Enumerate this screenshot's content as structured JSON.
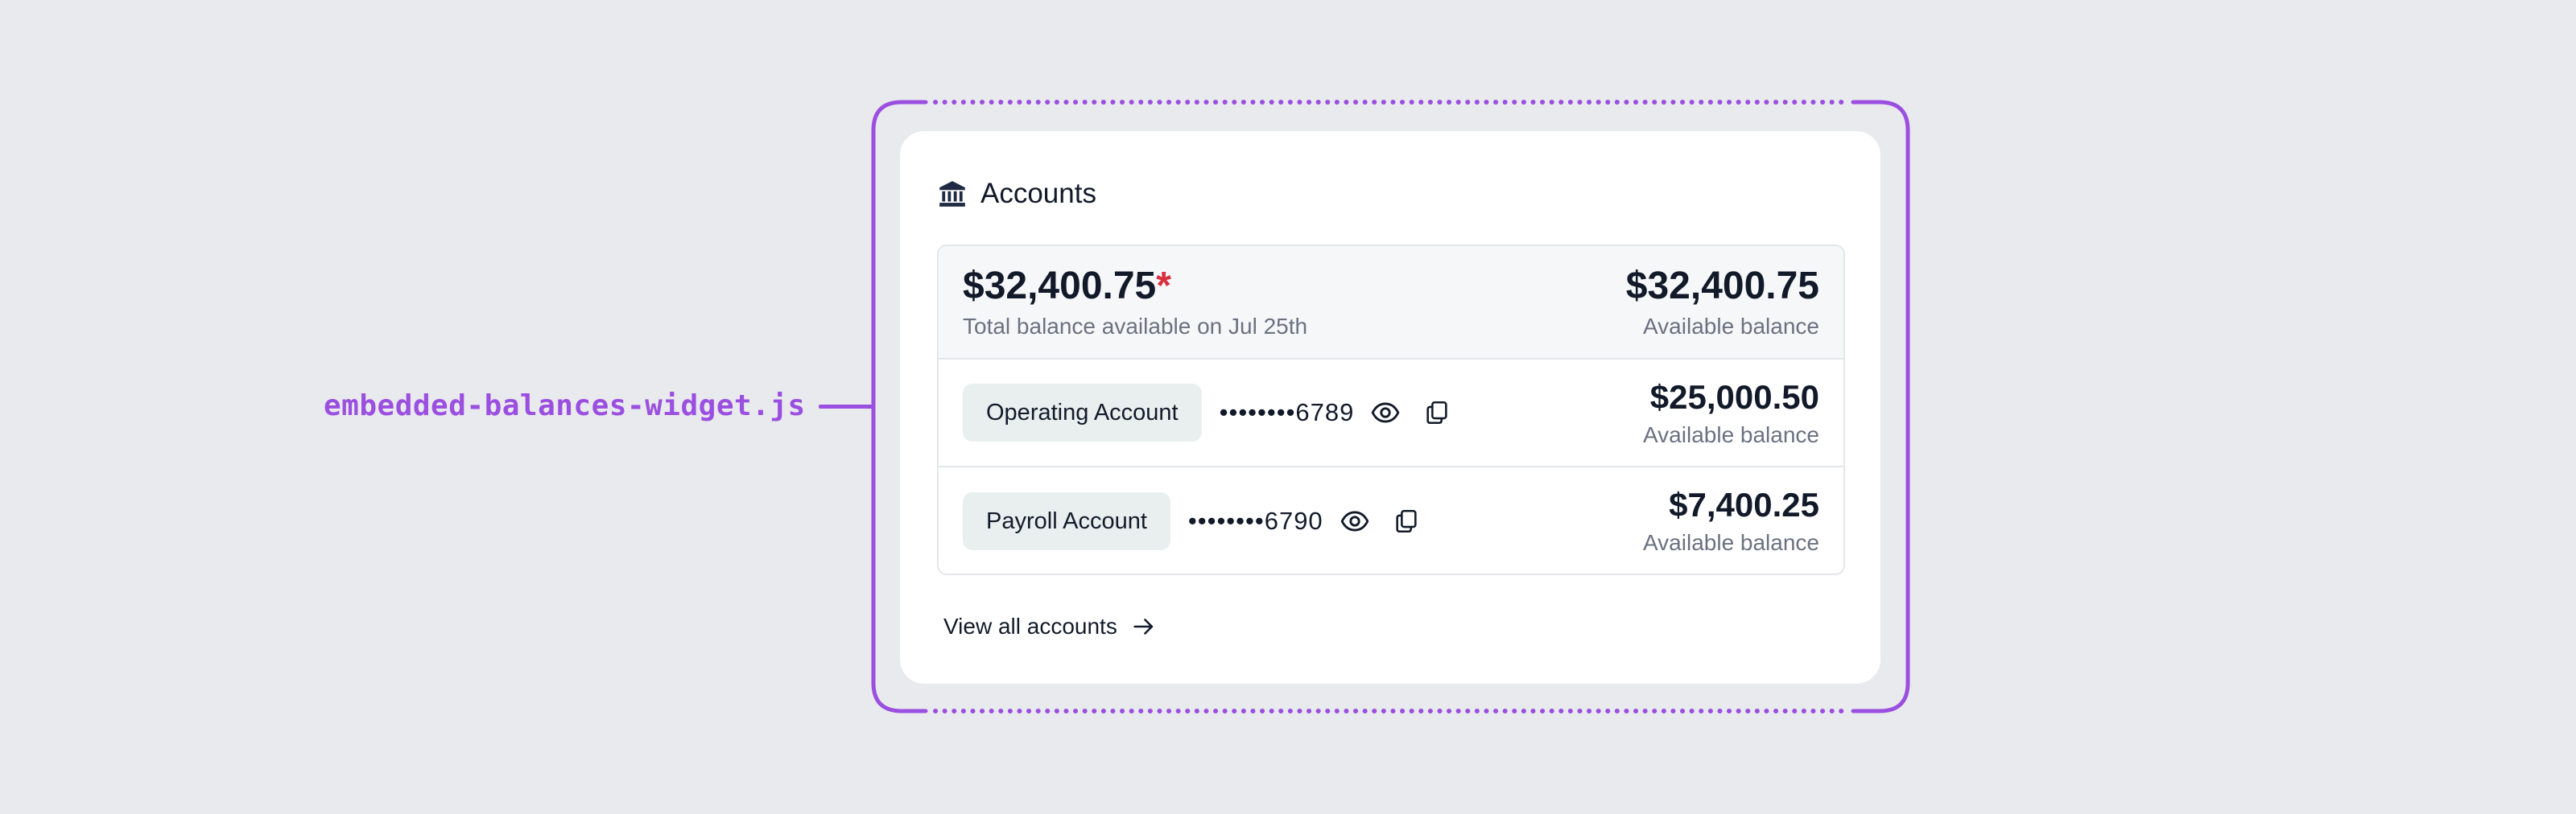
{
  "annotation": {
    "file_label": "embedded-balances-widget.js",
    "accent_color": "#9b4fe0"
  },
  "card": {
    "title": "Accounts",
    "title_icon": "bank-icon",
    "total": {
      "amount": "$32,400.75",
      "asterisk": "*",
      "caption": "Total balance available on Jul 25th",
      "right_amount": "$32,400.75",
      "right_caption": "Available balance"
    },
    "accounts": [
      {
        "name": "Operating Account",
        "masked_number": "••••••••6789",
        "balance": "$25,000.50",
        "balance_caption": "Available balance"
      },
      {
        "name": "Payroll Account",
        "masked_number": "••••••••6790",
        "balance": "$7,400.25",
        "balance_caption": "Available balance"
      }
    ],
    "footer_link": "View all accounts"
  }
}
